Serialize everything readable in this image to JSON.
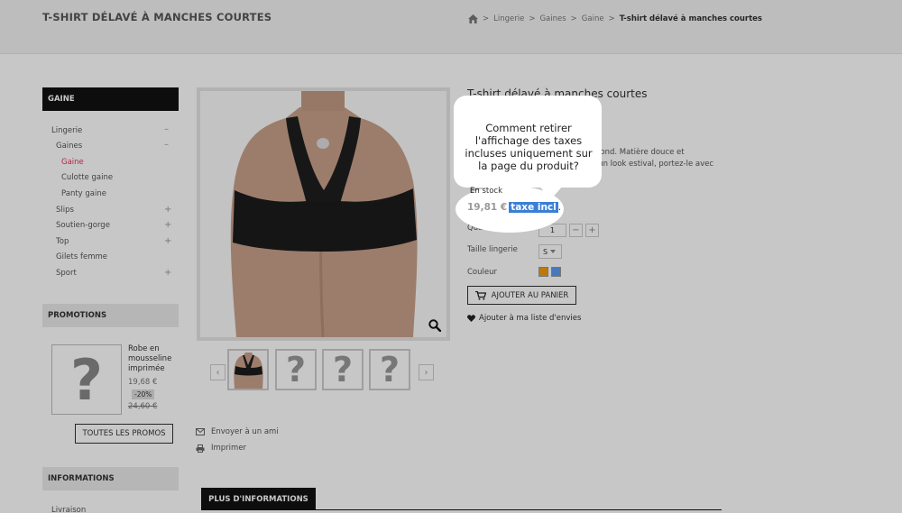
{
  "header": {
    "page_title": "T-SHIRT DÉLAVÉ À MANCHES COURTES",
    "breadcrumb": [
      {
        "label": "Lingerie"
      },
      {
        "label": "Gaines"
      },
      {
        "label": "Gaine"
      }
    ],
    "breadcrumb_current": "T-shirt délavé à manches courtes",
    "breadcrumb_separator": ">"
  },
  "sidebar": {
    "categories_title": "GAINE",
    "categories": [
      {
        "label": "Lingerie",
        "toggle": "–"
      },
      {
        "label": "Gaines",
        "toggle": "–"
      },
      {
        "label": "Gaine",
        "toggle": ""
      },
      {
        "label": "Culotte gaine",
        "toggle": ""
      },
      {
        "label": "Panty gaine",
        "toggle": ""
      },
      {
        "label": "Slips",
        "toggle": "+"
      },
      {
        "label": "Soutien-gorge",
        "toggle": "+"
      },
      {
        "label": "Top",
        "toggle": "+"
      },
      {
        "label": "Gilets femme",
        "toggle": ""
      },
      {
        "label": "Sport",
        "toggle": "+"
      }
    ],
    "promotions_title": "PROMOTIONS",
    "promo": {
      "name": "Robe en mousseline imprimée",
      "price": "19,68 €",
      "discount": "-20%",
      "old_price": "24,60 €",
      "button": "TOUTES LES PROMOS"
    },
    "informations_title": "INFORMATIONS",
    "info_first_link": "Livraison"
  },
  "product": {
    "title": "T-shirt délavé à manches courtes",
    "description_lines": [
      "l rond. Matière douce et",
      "r un look estival, portez-le avec"
    ],
    "stock": "En stock",
    "price": "19,81 €",
    "tax_label": "taxe incl",
    "tax_suffix": ".",
    "quantity_label": "Quantité",
    "quantity_value": "1",
    "qty_minus": "−",
    "qty_plus": "+",
    "size_label": "Taille lingerie",
    "size_value": "S",
    "color_label": "Couleur",
    "colors": [
      "#f39c11",
      "#5d9cec"
    ],
    "add_to_cart": "AJOUTER AU PANIER",
    "wishlist": "Ajouter à ma liste d'envies",
    "send_friend": "Envoyer à un ami",
    "print": "Imprimer",
    "more_info_tab": "PLUS D'INFORMATIONS",
    "thumb_prev": "‹",
    "thumb_next": "›",
    "placeholder_glyph": "?"
  },
  "callout": {
    "text": "Comment retirer l'affichage des taxes incluses uniquement sur la page du produit?"
  },
  "icons": [
    "home-icon",
    "zoom-icon",
    "envelope-icon",
    "printer-icon",
    "cart-icon",
    "heart-icon",
    "chevron-down-icon"
  ]
}
